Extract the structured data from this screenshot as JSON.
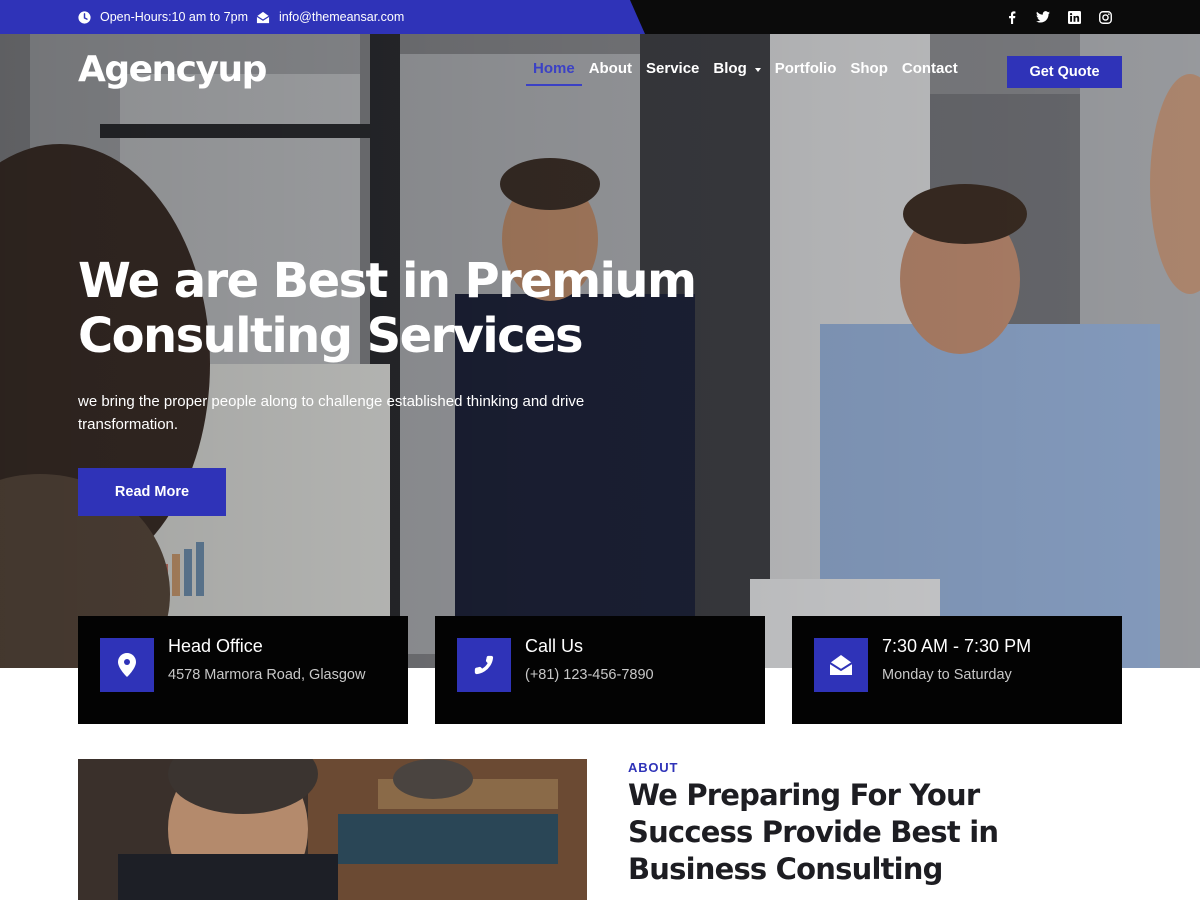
{
  "topbar": {
    "hours": "Open-Hours:10 am to 7pm",
    "email": "info@themeansar.com",
    "socials": [
      "facebook-icon",
      "twitter-icon",
      "linkedin-icon",
      "instagram-icon"
    ]
  },
  "header": {
    "logo": "Agencyup",
    "nav": [
      {
        "label": "Home",
        "active": true
      },
      {
        "label": "About"
      },
      {
        "label": "Service"
      },
      {
        "label": "Blog",
        "dropdown": true
      },
      {
        "label": "Portfolio"
      },
      {
        "label": "Shop"
      },
      {
        "label": "Contact"
      }
    ],
    "cta": "Get Quote"
  },
  "hero": {
    "title_line1": "We are Best in Premium",
    "title_line2": "Consulting Services",
    "subtitle": "we bring the proper people along to challenge established thinking and drive transformation.",
    "button": "Read More"
  },
  "info": [
    {
      "icon": "location-pin-icon",
      "title": "Head Office",
      "text": "4578 Marmora Road, Glasgow"
    },
    {
      "icon": "phone-icon",
      "title": "Call Us",
      "text": "(+81) 123-456-7890"
    },
    {
      "icon": "envelope-open-icon",
      "title": "7:30 AM - 7:30 PM",
      "text": "Monday to Saturday"
    }
  ],
  "about": {
    "label": "ABOUT",
    "title": "We Preparing For Your Success Provide Best in Business Consulting"
  },
  "colors": {
    "accent": "#2f33b8",
    "dark": "#0b0b0b"
  }
}
